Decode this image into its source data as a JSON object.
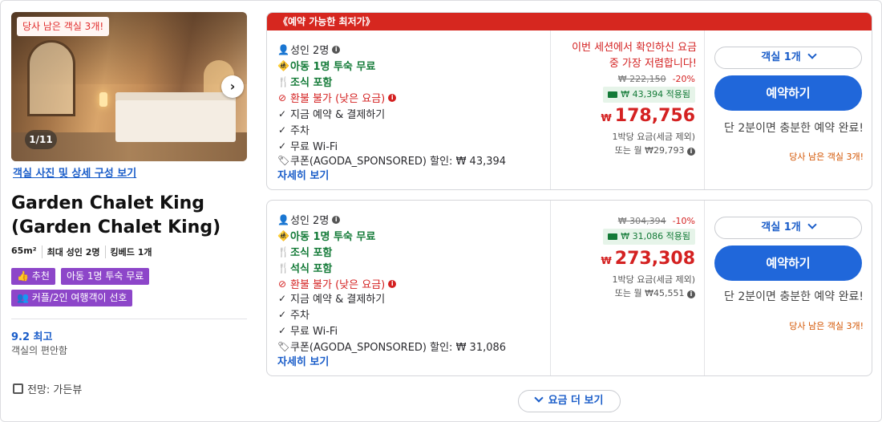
{
  "room": {
    "photo_badge": "당사 남은 객실 3개!",
    "photo_counter": "1/11",
    "photo_link": "객실 사진 및 상세 구성 보기",
    "name_line1": "Garden Chalet King",
    "name_line2": "(Garden Chalet King)",
    "specs": [
      "65m²",
      "최대 성인 2명",
      "킹베드 1개"
    ],
    "chips": [
      "추천",
      "아동 1명 투숙 무료",
      "커플/2인 여행객이 선호"
    ],
    "score": "9.2 최고",
    "score_sub": "객실의 편안함",
    "view": "전망: 가든뷰"
  },
  "offers": [
    {
      "banner": "《예약 가능한 최저가》",
      "features": {
        "adults": "성인 2명",
        "child": "아동 1명 투숙 무료",
        "breakfast": "조식 포함",
        "refund": "환불 불가 (낮은 요금)",
        "pay": "지금 예약 & 결제하기",
        "parking": "주차",
        "wifi": "무료 Wi-Fi",
        "coupon": "쿠폰(AGODA_SPONSORED) 할인: ₩ 43,394",
        "more": "자세히 보기"
      },
      "session_msg": "이번 세션에서 확인하신 요금 중 가장 저렴합니다!",
      "original_price": "₩ 222,150",
      "discount": "-20%",
      "applied": "₩ 43,394 적용됨",
      "price_currency": "₩",
      "price": "178,756",
      "price_note": "1박당 요금(세금 제외)",
      "monthly": "또는 월 ₩29,793",
      "rooms_select": "객실 1개",
      "book_label": "예약하기",
      "fast_note": "단 2분이면 충분한 예약 완료!",
      "left_note": "당사 남은 객실 3개!"
    },
    {
      "features": {
        "adults": "성인 2명",
        "child": "아동 1명 투숙 무료",
        "breakfast": "조식 포함",
        "dinner": "석식 포함",
        "refund": "환불 불가 (낮은 요금)",
        "pay": "지금 예약 & 결제하기",
        "parking": "주차",
        "wifi": "무료 Wi-Fi",
        "coupon": "쿠폰(AGODA_SPONSORED) 할인: ₩ 31,086",
        "more": "자세히 보기"
      },
      "original_price": "₩ 304,394",
      "discount": "-10%",
      "applied": "₩ 31,086 적용됨",
      "price_currency": "₩",
      "price": "273,308",
      "price_note": "1박당 요금(세금 제외)",
      "monthly": "또는 월 ₩45,551",
      "rooms_select": "객실 1개",
      "book_label": "예약하기",
      "fast_note": "단 2분이면 충분한 예약 완료!",
      "left_note": "당사 남은 객실 3개!"
    }
  ],
  "more_rates": "요금 더 보기",
  "colors": {
    "accent_blue": "#2067da",
    "price_red": "#d42121",
    "green": "#137a37",
    "chip_purple": "#8d46c9",
    "banner_red": "#d6271f"
  }
}
